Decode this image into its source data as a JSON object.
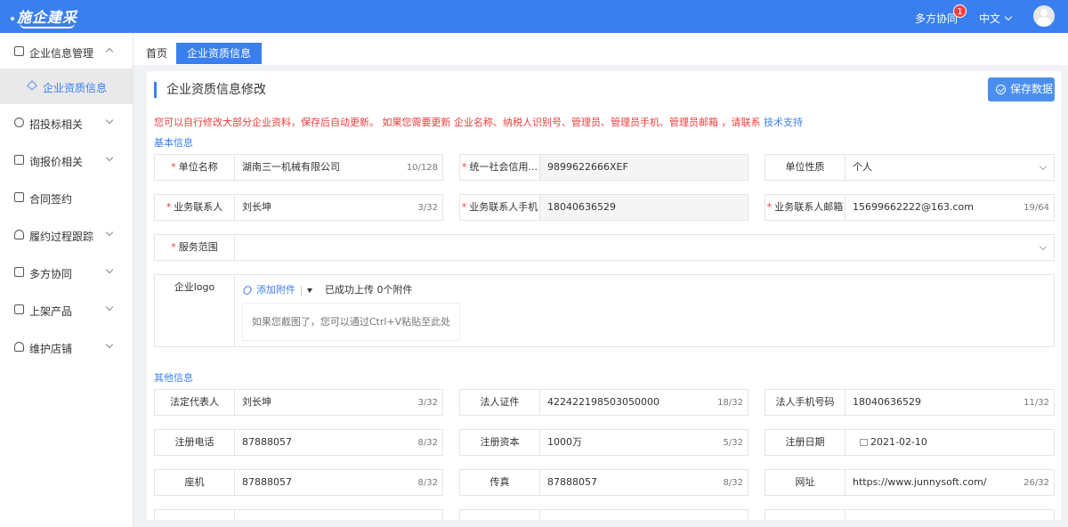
{
  "app": {
    "logo_text": "施企建采"
  },
  "topbar": {
    "collab": "多方协同",
    "badge_count": "1",
    "language": "中文"
  },
  "sidebar": {
    "items": [
      {
        "label": "企业信息管理"
      },
      {
        "label": "企业资质信息"
      },
      {
        "label": "招投标相关"
      },
      {
        "label": "询报价相关"
      },
      {
        "label": "合同签约"
      },
      {
        "label": "履约过程跟踪"
      },
      {
        "label": "多方协同"
      },
      {
        "label": "上架产品"
      },
      {
        "label": "维护店铺"
      }
    ]
  },
  "tabs": [
    {
      "label": "首页"
    },
    {
      "label": "企业资质信息"
    }
  ],
  "page": {
    "title": "企业资质信息修改",
    "save_label": "保存数据",
    "notice_text": "您可以自行修改大部分企业资料，保存后自动更新。 如果您需要更新 企业名称、纳税人识别号、管理员、管理员手机、管理员邮箱 ，请联系",
    "notice_link": "技术支持",
    "basic_section": "基本信息",
    "other_section": "其他信息"
  },
  "basic": {
    "company_name": {
      "label": "单位名称",
      "value": "湖南三一机械有限公司",
      "count": "10/128"
    },
    "credit_code": {
      "label": "统一社会信用...",
      "value": "9899622666XEF"
    },
    "unit_type": {
      "label": "单位性质",
      "value": "个人"
    },
    "contact": {
      "label": "业务联系人",
      "value": "刘长坤",
      "count": "3/32"
    },
    "contact_phone": {
      "label": "业务联系人手机",
      "value": "18040636529"
    },
    "contact_email": {
      "label": "业务联系人邮箱",
      "value": "15699662222@163.com",
      "count": "19/64"
    },
    "service_scope": {
      "label": "服务范围",
      "value": ""
    },
    "logo": {
      "label": "企业logo",
      "add_label": "添加附件",
      "upload_status": "已成功上传 0个附件",
      "paste_hint": "如果您截图了，您可以通过Ctrl+V粘贴至此处"
    }
  },
  "other": {
    "legal_rep": {
      "label": "法定代表人",
      "value": "刘长坤",
      "count": "3/32"
    },
    "legal_id": {
      "label": "法人证件",
      "value": "422422198503050000",
      "count": "18/32"
    },
    "legal_phone": {
      "label": "法人手机号码",
      "value": "18040636529",
      "count": "11/32"
    },
    "reg_phone": {
      "label": "注册电话",
      "value": "87888057",
      "count": "8/32"
    },
    "reg_capital": {
      "label": "注册资本",
      "value": "1000万",
      "count": "5/32"
    },
    "reg_date": {
      "label": "注册日期",
      "value": "2021-02-10"
    },
    "landline": {
      "label": "座机",
      "value": "87888057",
      "count": "8/32"
    },
    "fax": {
      "label": "传真",
      "value": "87888057",
      "count": "8/32"
    },
    "website": {
      "label": "网址",
      "value": "https://www.junnysoft.com/",
      "count": "26/32"
    }
  }
}
